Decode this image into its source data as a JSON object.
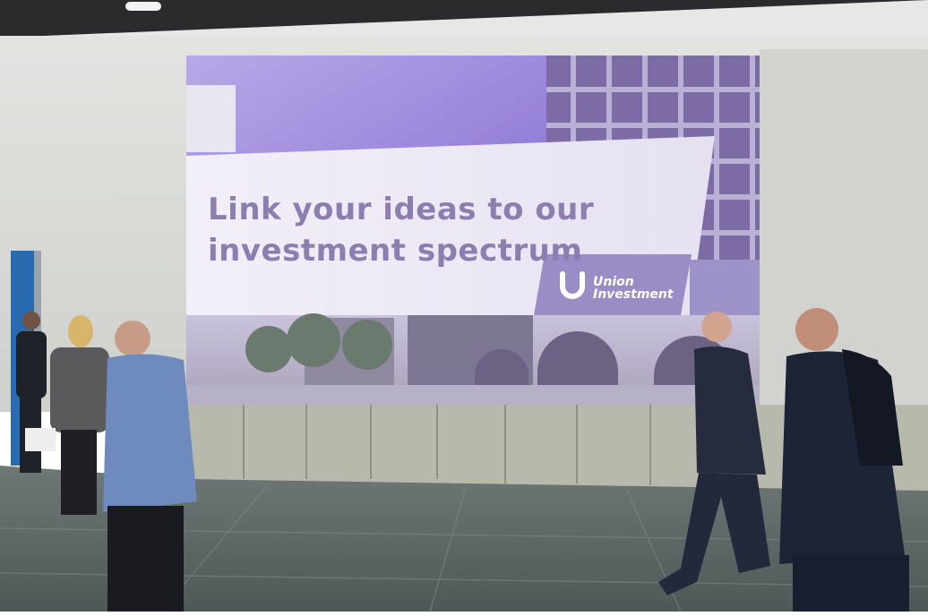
{
  "slide": {
    "headline_line1": "Link your ideas to our",
    "headline_line2": "investment spectrum",
    "brand_line1": "Union",
    "brand_line2": "Investment"
  },
  "colors": {
    "ceiling": "#2b2b2e",
    "wall": "#d9dad6",
    "floor": "#5f6866",
    "screen_purple": "#8e7bd3",
    "headline": "#8c7fb0",
    "logo_bg": "#9a8cc4"
  },
  "icons": {
    "brand_logo": "union-investment-logo-icon"
  }
}
